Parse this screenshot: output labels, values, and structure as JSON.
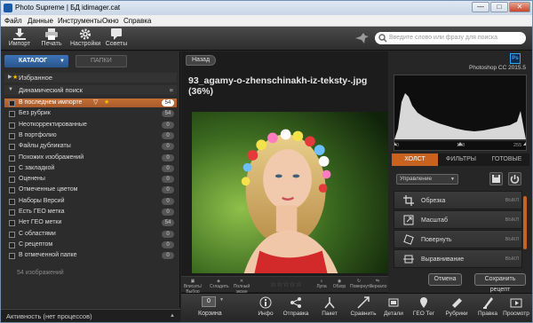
{
  "window": {
    "title": "Photo Supreme | БД idimager.cat"
  },
  "menu": [
    "Файл",
    "Данные",
    "Инструменты",
    "Окно",
    "Справка"
  ],
  "toolbar": [
    {
      "label": "Импорт",
      "icon": "import-icon"
    },
    {
      "label": "Печать",
      "icon": "print-icon"
    },
    {
      "label": "Настройки",
      "icon": "gear-icon"
    },
    {
      "label": "Советы",
      "icon": "tips-icon"
    }
  ],
  "search": {
    "placeholder": "Введите слово или фразу для поиска"
  },
  "left": {
    "tab_catalog": "КАТАЛОГ",
    "tab_folders": "ПАПКИ",
    "sections": [
      "Избранное",
      "Динамический поиск"
    ],
    "items": [
      {
        "label": "В последнем импорте",
        "count": "54",
        "selected": true
      },
      {
        "label": "Без рубрик",
        "count": "54"
      },
      {
        "label": "Неоткорректированные",
        "count": "0"
      },
      {
        "label": "В портфолио",
        "count": "0"
      },
      {
        "label": "Файлы дубликаты",
        "count": "0"
      },
      {
        "label": "Похожих изображений",
        "count": "0"
      },
      {
        "label": "С закладкой",
        "count": "0"
      },
      {
        "label": "Оценены",
        "count": "0"
      },
      {
        "label": "Отмеченные цветом",
        "count": "0"
      },
      {
        "label": "Наборы Версий",
        "count": "0"
      },
      {
        "label": "Есть ГЕО метка",
        "count": "0"
      },
      {
        "label": "Нет ГЕО метки",
        "count": "54"
      },
      {
        "label": "С областями",
        "count": "0"
      },
      {
        "label": "С рецептом",
        "count": "0"
      },
      {
        "label": "В отмеченной папке",
        "count": "0"
      }
    ],
    "image_count": "54 изображений",
    "status": "Активность (нет процессов)"
  },
  "center": {
    "back": "Назад",
    "filename": "93_agamy-o-zhenschinakh-iz-teksty-.jpg (36%)",
    "viewbar": [
      "Вписать/Выбор",
      "Сгладить",
      "Полный экран",
      "Лупа",
      "Обзор",
      "Повернуть",
      "Зеркало"
    ]
  },
  "right": {
    "app_label": "Photoshop CC 2015.5",
    "ps_icon": "Ps",
    "histo_ticks": [
      "0",
      "128",
      "255"
    ],
    "tabs": [
      "ХОЛСТ",
      "ФИЛЬТРЫ",
      "ГОТОВЫЕ"
    ],
    "select": "Управление",
    "tools": [
      {
        "label": "Обрезка",
        "off": "ВЫКЛ"
      },
      {
        "label": "Масштаб",
        "off": "ВЫКЛ"
      },
      {
        "label": "Повернуть",
        "off": "ВЫКЛ"
      },
      {
        "label": "Выравнивание",
        "off": "ВЫКЛ"
      }
    ],
    "cancel": "Отмена",
    "save": "Сохранить рецепт"
  },
  "bottom": {
    "basket": "Корзина",
    "basket_count": "0",
    "buttons": [
      "Инфо",
      "Отправка",
      "Пакет",
      "Сравнить",
      "Детали",
      "ГЕО Тег",
      "Рубрики",
      "Правка",
      "Просмотр"
    ]
  },
  "colors": {
    "accent": "#c9611f",
    "selected": "#c46e35",
    "catalog_tab": "#2a568c"
  }
}
